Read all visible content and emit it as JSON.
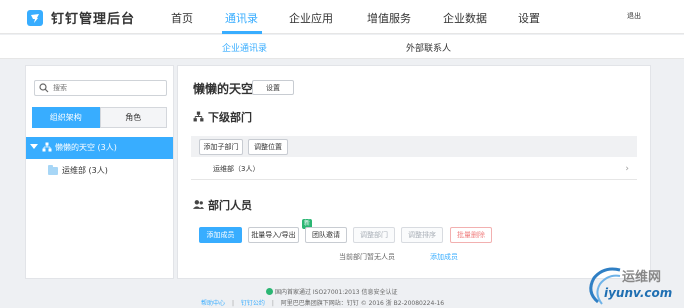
{
  "app": {
    "title": "钉钉管理后台",
    "logout": "退出"
  },
  "nav": {
    "items": [
      {
        "label": "首页"
      },
      {
        "label": "通讯录"
      },
      {
        "label": "企业应用"
      },
      {
        "label": "增值服务"
      },
      {
        "label": "企业数据"
      },
      {
        "label": "设置"
      }
    ],
    "active": "通讯录"
  },
  "subnav": {
    "items": [
      {
        "label": "企业通讯录"
      },
      {
        "label": "外部联系人"
      }
    ],
    "active": "企业通讯录"
  },
  "sidebar": {
    "search_placeholder": "搜索",
    "tabs": [
      {
        "label": "组织架构"
      },
      {
        "label": "角色"
      }
    ],
    "active_tab": "组织架构",
    "tree": {
      "root_label": "懒懒的天空 (3人)",
      "children": [
        {
          "label": "运维部 (3人)"
        }
      ]
    }
  },
  "main": {
    "company_name": "懒懒的天空",
    "settings_button": "设置",
    "subdept_section": {
      "title": "下级部门",
      "buttons": [
        {
          "label": "添加子部门"
        },
        {
          "label": "调整位置"
        }
      ],
      "rows": [
        {
          "label": "运维部（3人）"
        }
      ]
    },
    "members_section": {
      "title": "部门人员",
      "buttons": [
        {
          "label": "添加成员",
          "style": "primary"
        },
        {
          "label": "批量导入/导出",
          "style": "default",
          "badge": "新"
        },
        {
          "label": "团队邀请",
          "style": "default"
        },
        {
          "label": "调整部门",
          "style": "disabled"
        },
        {
          "label": "调整排序",
          "style": "disabled"
        },
        {
          "label": "批量删除",
          "style": "danger"
        }
      ],
      "empty_text": "当前部门暂无人员",
      "empty_link": "添加成员"
    }
  },
  "footer": {
    "security_note": "国内首家通过 ISO27001:2013 信息安全认证",
    "links": [
      {
        "label": "帮助中心"
      },
      {
        "label": "钉钉公约"
      }
    ],
    "copyright": "阿里巴巴集团旗下网站：钉钉 © 2016 浙 B2-20080224-16"
  },
  "watermark": {
    "cn": "运维网",
    "en": "iyunv.com"
  },
  "colors": {
    "accent": "#38adff",
    "success": "#2bb673",
    "danger": "#f08080"
  }
}
